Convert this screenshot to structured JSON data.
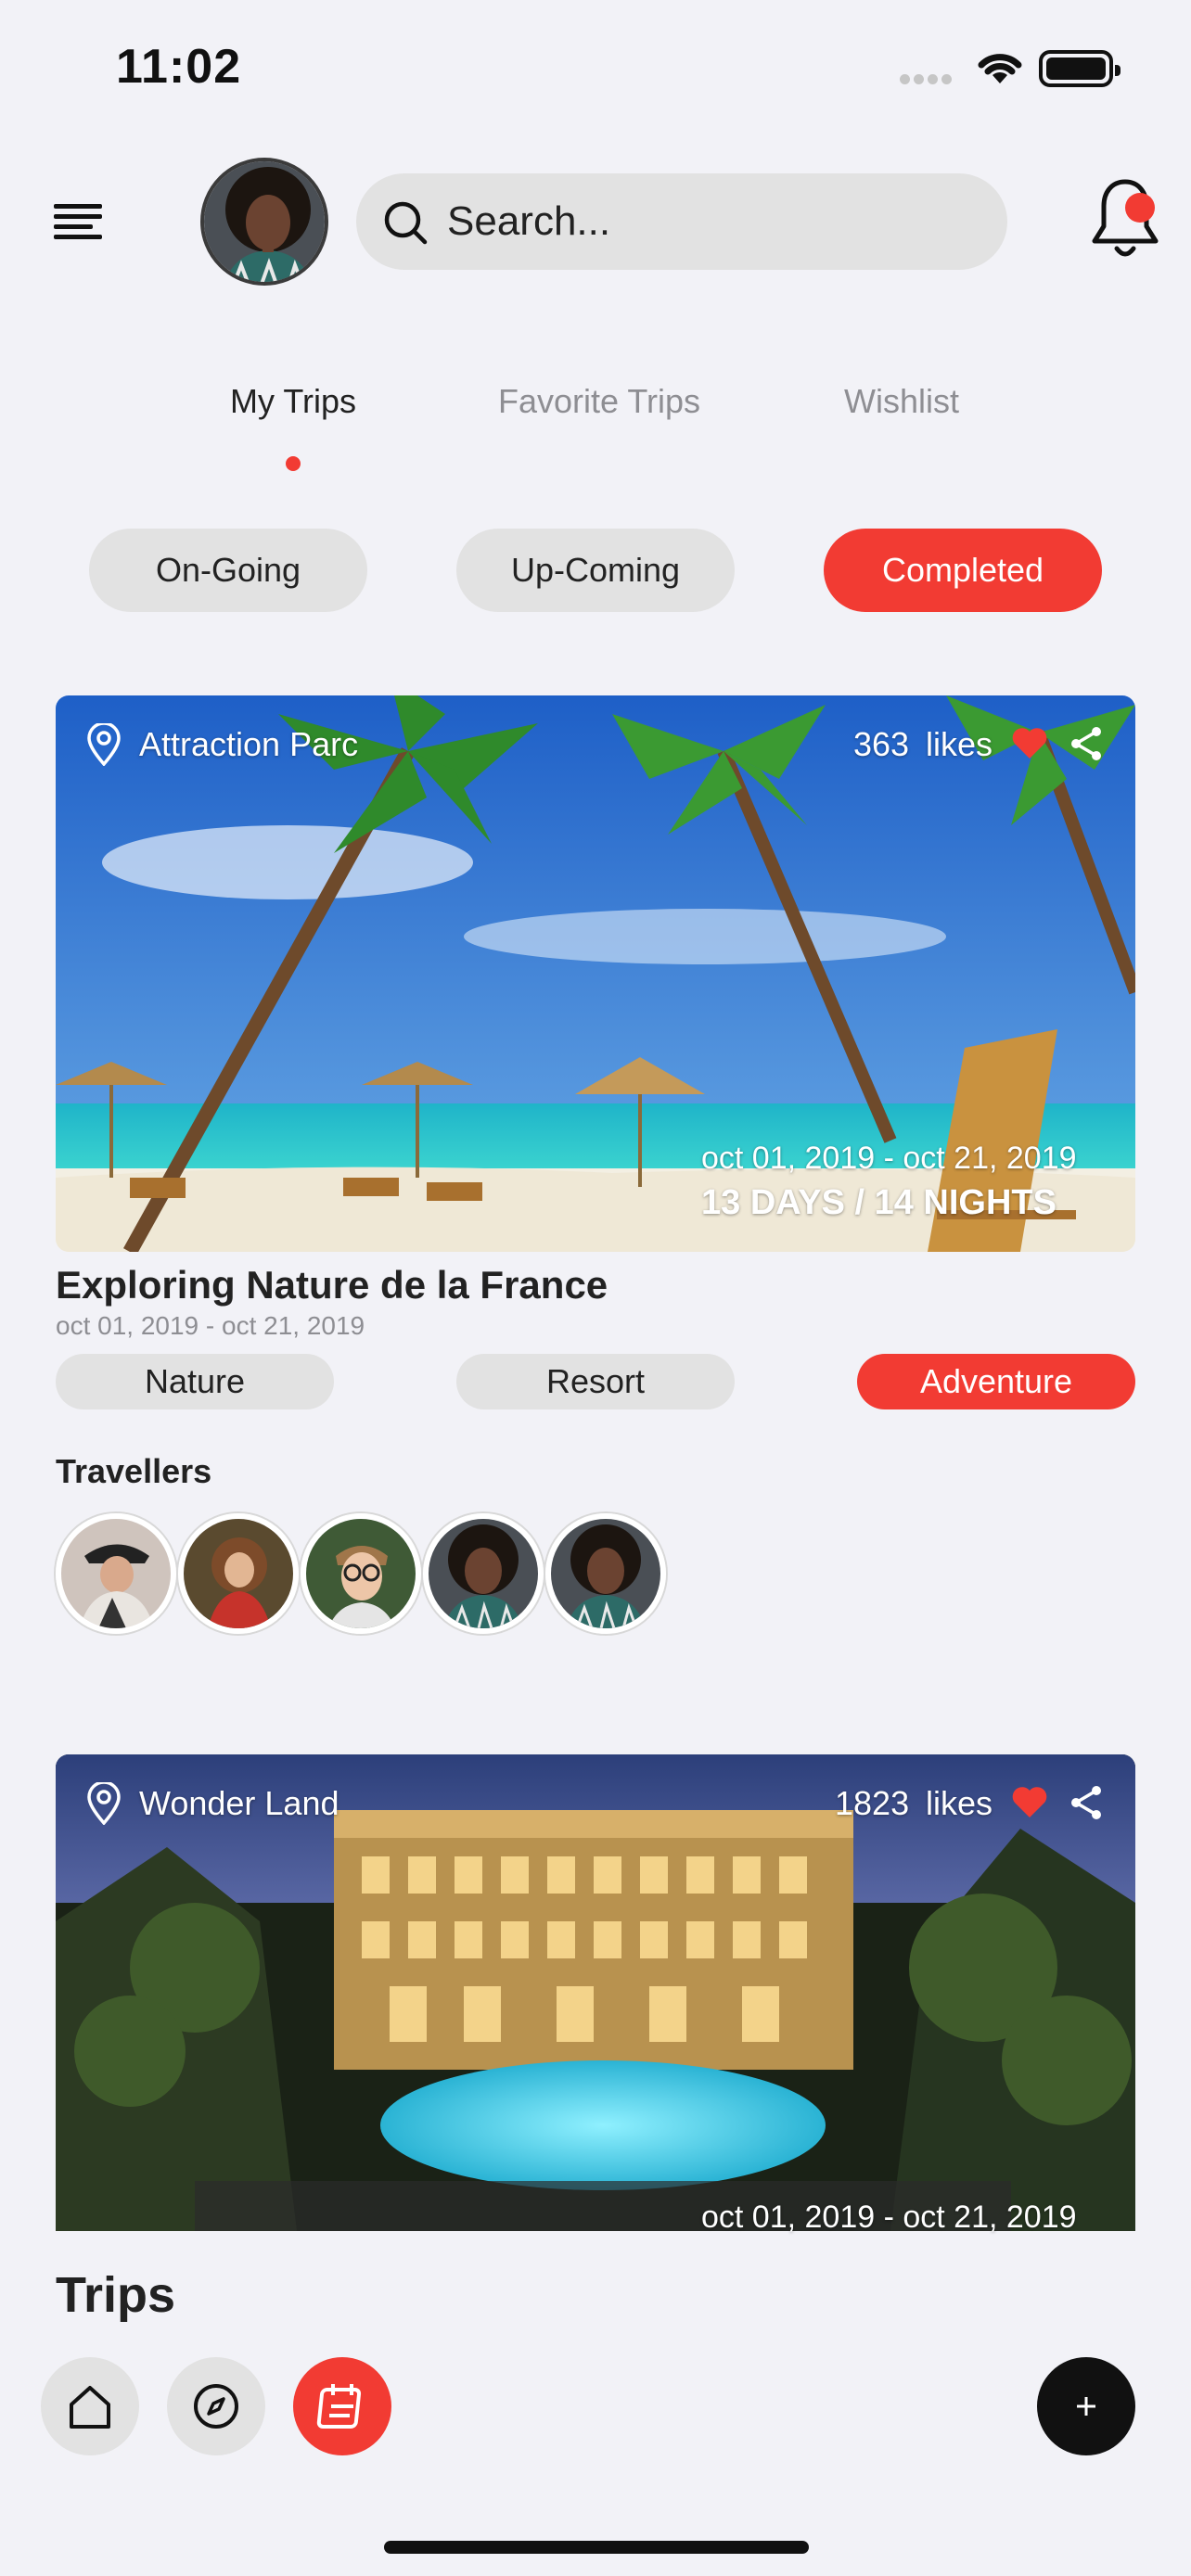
{
  "status_bar": {
    "time": "11:02"
  },
  "header": {
    "search": {
      "placeholder": "Search..."
    }
  },
  "tabs": [
    {
      "label": "My Trips",
      "active": true
    },
    {
      "label": "Favorite Trips",
      "active": false
    },
    {
      "label": "Wishlist",
      "active": false
    }
  ],
  "filters": [
    {
      "label": "On-Going",
      "active": false
    },
    {
      "label": "Up-Coming",
      "active": false
    },
    {
      "label": "Completed",
      "active": true
    }
  ],
  "trips": [
    {
      "location": "Attraction Parc",
      "likes": "363",
      "likes_suffix": "likes",
      "dates_overlay": "oct 01, 2019 - oct 21, 2019",
      "duration": "13 DAYS / 14 NIGHTS",
      "title": "Exploring Nature de la France",
      "dates": "oct 01, 2019 - oct 21, 2019",
      "tags": [
        {
          "label": "Nature",
          "active": false
        },
        {
          "label": "Resort",
          "active": false
        },
        {
          "label": "Adventure",
          "active": true
        }
      ],
      "travellers_label": "Travellers"
    },
    {
      "location": "Wonder Land",
      "likes": "1823",
      "likes_suffix": "likes",
      "dates_overlay": "oct 01, 2019 - oct 21, 2019"
    }
  ],
  "bottom": {
    "section_title": "Trips"
  },
  "colors": {
    "accent": "#f23b33",
    "background": "#f2f2f7",
    "chip": "#e2e2e2"
  }
}
